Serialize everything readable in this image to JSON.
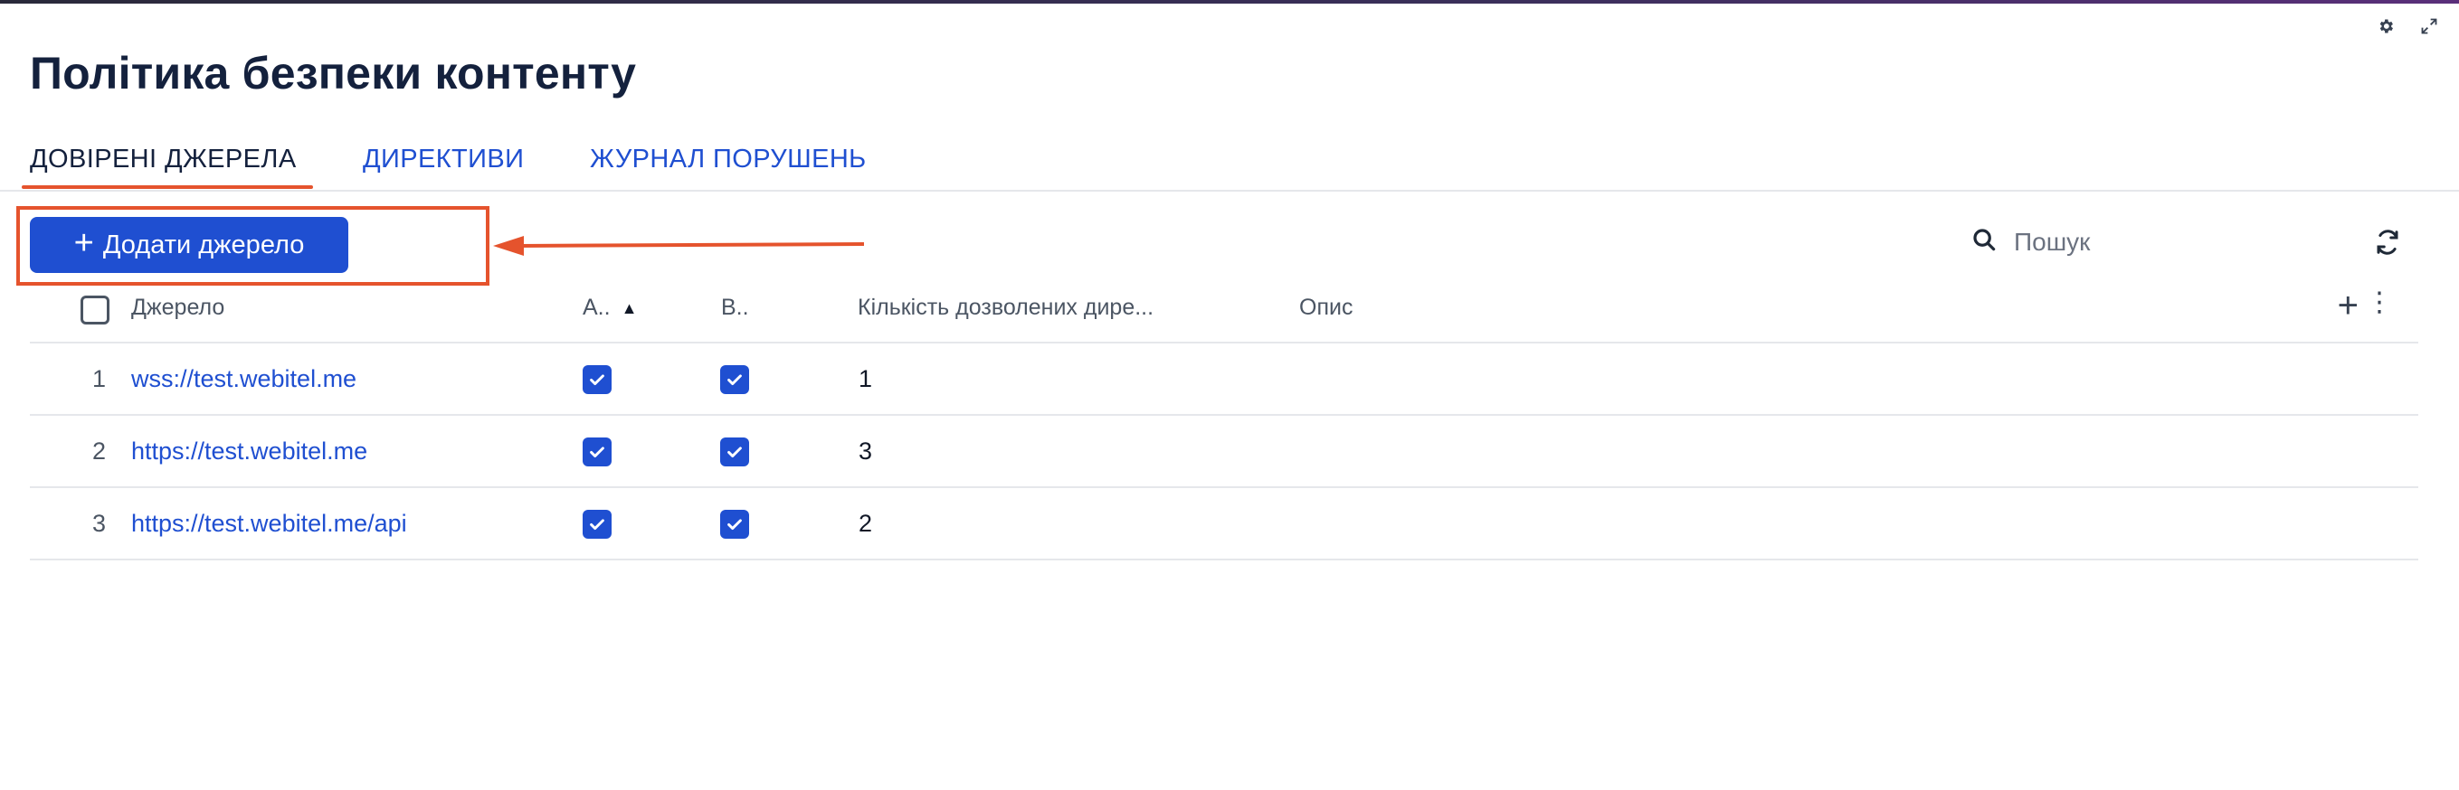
{
  "page": {
    "title": "Політика безпеки контенту"
  },
  "tabs": [
    {
      "label": "ДОВІРЕНІ ДЖЕРЕЛА",
      "active": true
    },
    {
      "label": "ДИРЕКТИВИ",
      "active": false
    },
    {
      "label": "ЖУРНАЛ ПОРУШЕНЬ",
      "active": false
    }
  ],
  "toolbar": {
    "add_label": "Додати джерело",
    "search_placeholder": "Пошук"
  },
  "table": {
    "columns": {
      "source": "Джерело",
      "col_a": "А..",
      "col_b": "В..",
      "allowed_count": "Кількість дозволених дире...",
      "description": "Опис"
    },
    "rows": [
      {
        "num": "1",
        "source": "wss://test.webitel.me",
        "a": true,
        "b": true,
        "count": "1",
        "description": ""
      },
      {
        "num": "2",
        "source": "https://test.webitel.me",
        "a": true,
        "b": true,
        "count": "3",
        "description": ""
      },
      {
        "num": "3",
        "source": "https://test.webitel.me/api",
        "a": true,
        "b": true,
        "count": "2",
        "description": ""
      }
    ]
  },
  "colors": {
    "accent": "#1f4fd1",
    "highlight": "#e5532d",
    "title": "#14213d"
  },
  "icons": [
    "gear-icon",
    "expand-icon",
    "plus-icon",
    "search-icon",
    "refresh-icon",
    "sort-up-icon",
    "kebab-menu-icon",
    "checkbox-checked-icon"
  ]
}
